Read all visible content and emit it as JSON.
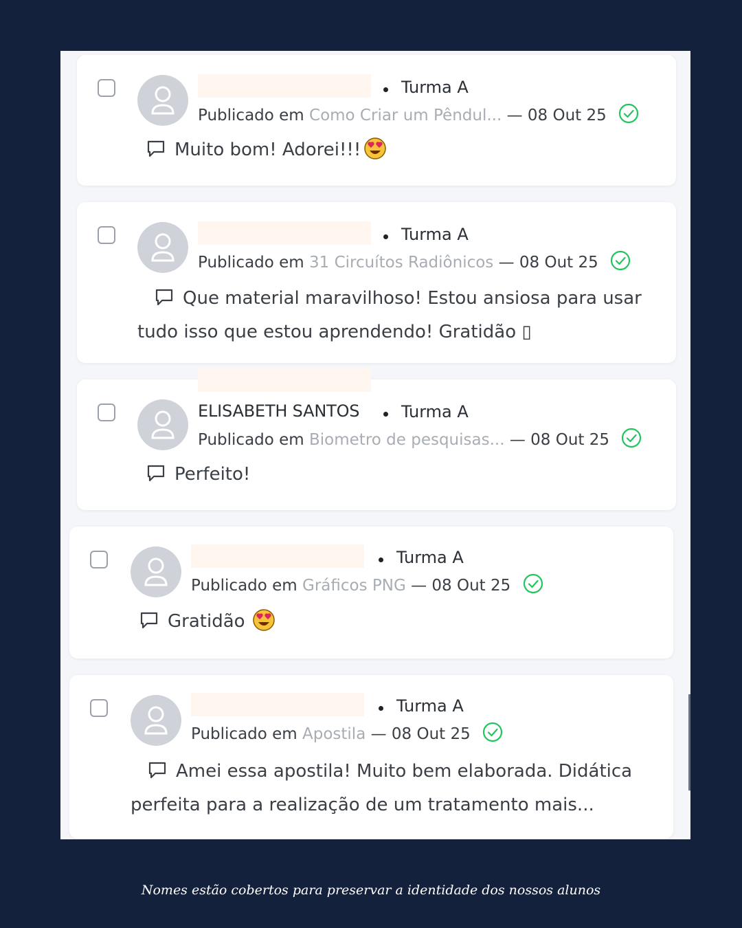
{
  "comments": [
    {
      "name": "",
      "group": "Turma A",
      "published_label": "Publicado em",
      "post": "Como Criar um Pêndul...",
      "date": "— 08 Out 25",
      "text": "Muito bom! Adorei!!!",
      "emoji": "heart-eyes"
    },
    {
      "name": "",
      "group": "Turma A",
      "published_label": "Publicado em",
      "post": "31 Circuítos Radiônicos",
      "date": "— 08 Out 25",
      "text": "Que material maravilhoso! Estou ansiosa para usar tudo isso que estou aprendendo! Gratidão ▯",
      "emoji": ""
    },
    {
      "name": "ELISABETH SANTOS",
      "group": "Turma A",
      "published_label": "Publicado em",
      "post": "Biometro de pesquisas...",
      "date": "— 08 Out 25",
      "text": "Perfeito!",
      "emoji": ""
    },
    {
      "name": "",
      "group": "Turma A",
      "published_label": "Publicado em",
      "post": "Gráficos PNG",
      "date": "— 08 Out 25",
      "text": "Gratidão",
      "emoji": "heart-eyes"
    },
    {
      "name": "",
      "group": "Turma A",
      "published_label": "Publicado em",
      "post": "Apostila",
      "date": "— 08 Out 25",
      "text": "Amei essa apostila! Muito bem elaborada. Didática perfeita para a realização de um tratamento mais...",
      "emoji": ""
    }
  ],
  "caption": "Nomes estão cobertos para preservar a identidade dos nossos alunos",
  "colors": {
    "background": "#14213d",
    "approved": "#22c55e",
    "post_link": "#a8adb4",
    "name_mask": "#fff6ef"
  },
  "icons": {
    "checkbox": "checkbox-icon",
    "avatar": "user-avatar-icon",
    "approved": "check-circle-icon",
    "comment": "speech-bubble-icon",
    "emoji": "heart-eyes-emoji"
  }
}
